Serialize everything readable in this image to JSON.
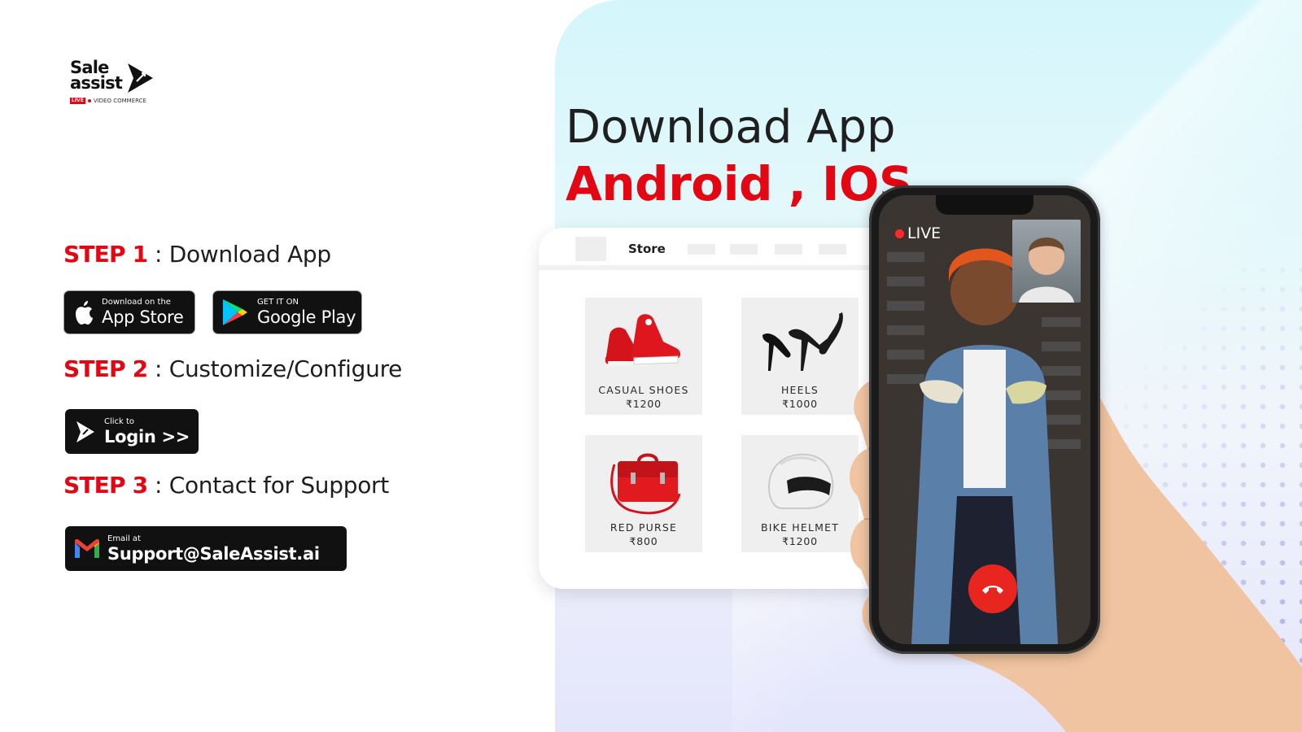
{
  "logo": {
    "line1": "Sale",
    "line2": "assist",
    "live": "LIVE",
    "tagline": "VIDEO COMMERCE"
  },
  "headline": {
    "line1": "Download App",
    "line2": "Android , IOS"
  },
  "steps": [
    {
      "num": "STEP 1",
      "text": " : Download App"
    },
    {
      "num": "STEP 2",
      "text": " : Customize/Configure"
    },
    {
      "num": "STEP 3",
      "text": " : Contact for Support"
    }
  ],
  "badges": {
    "appstore": {
      "small": "Download on the",
      "big": "App Store"
    },
    "googleplay": {
      "small": "GET IT ON",
      "big": "Google Play"
    },
    "login": {
      "small": "Click to",
      "big": "Login >>"
    },
    "support": {
      "small": "Email at",
      "big": "Support@SaleAssist.ai"
    }
  },
  "store": {
    "title": "Store",
    "products": [
      {
        "name": "CASUAL SHOES",
        "price": "₹1200"
      },
      {
        "name": "HEELS",
        "price": "₹1000"
      },
      {
        "name": "RED PURSE",
        "price": "₹800"
      },
      {
        "name": "BIKE HELMET",
        "price": "₹1200"
      }
    ]
  },
  "call": {
    "live": "LIVE"
  },
  "colors": {
    "accent": "#e30613",
    "dark": "#111111",
    "endcall": "#e8261f"
  }
}
